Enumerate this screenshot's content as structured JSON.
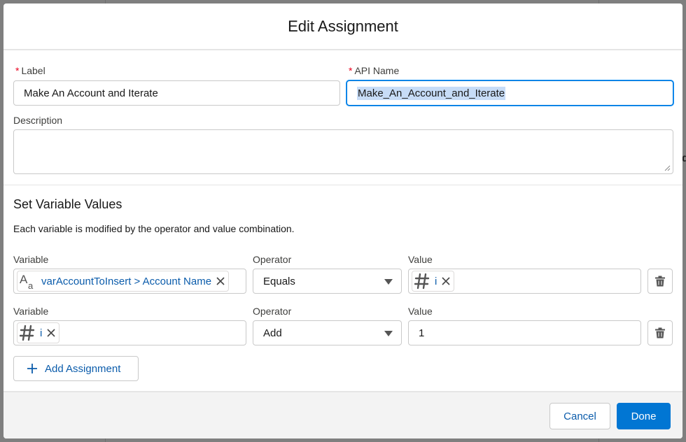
{
  "modal": {
    "title": "Edit Assignment"
  },
  "fields": {
    "label": {
      "label": "Label",
      "value": "Make An Account and Iterate"
    },
    "api_name": {
      "label": "API Name",
      "value": "Make_An_Account_and_Iterate"
    },
    "description": {
      "label": "Description",
      "value": ""
    },
    "required_mark": "*"
  },
  "section": {
    "title": "Set Variable Values",
    "help": "Each variable is modified by the operator and value combination."
  },
  "rows": [
    {
      "variable_label": "Variable",
      "variable_pill": "varAccountToInsert > Account Name",
      "variable_type_icon": "text-type-icon",
      "operator_label": "Operator",
      "operator": "Equals",
      "value_label": "Value",
      "value_pill": "i",
      "value_type_icon": "number-type-icon"
    },
    {
      "variable_label": "Variable",
      "variable_pill": "i",
      "variable_type_icon": "number-type-icon",
      "operator_label": "Operator",
      "operator": "Add",
      "value_label": "Value",
      "value": "1"
    }
  ],
  "add_assignment_label": "Add Assignment",
  "footer": {
    "cancel_label": "Cancel",
    "done_label": "Done"
  },
  "colors": {
    "brand": "#0176d3",
    "link": "#0b5cab",
    "required": "#ea001e",
    "footer_bg": "#f3f3f3"
  }
}
